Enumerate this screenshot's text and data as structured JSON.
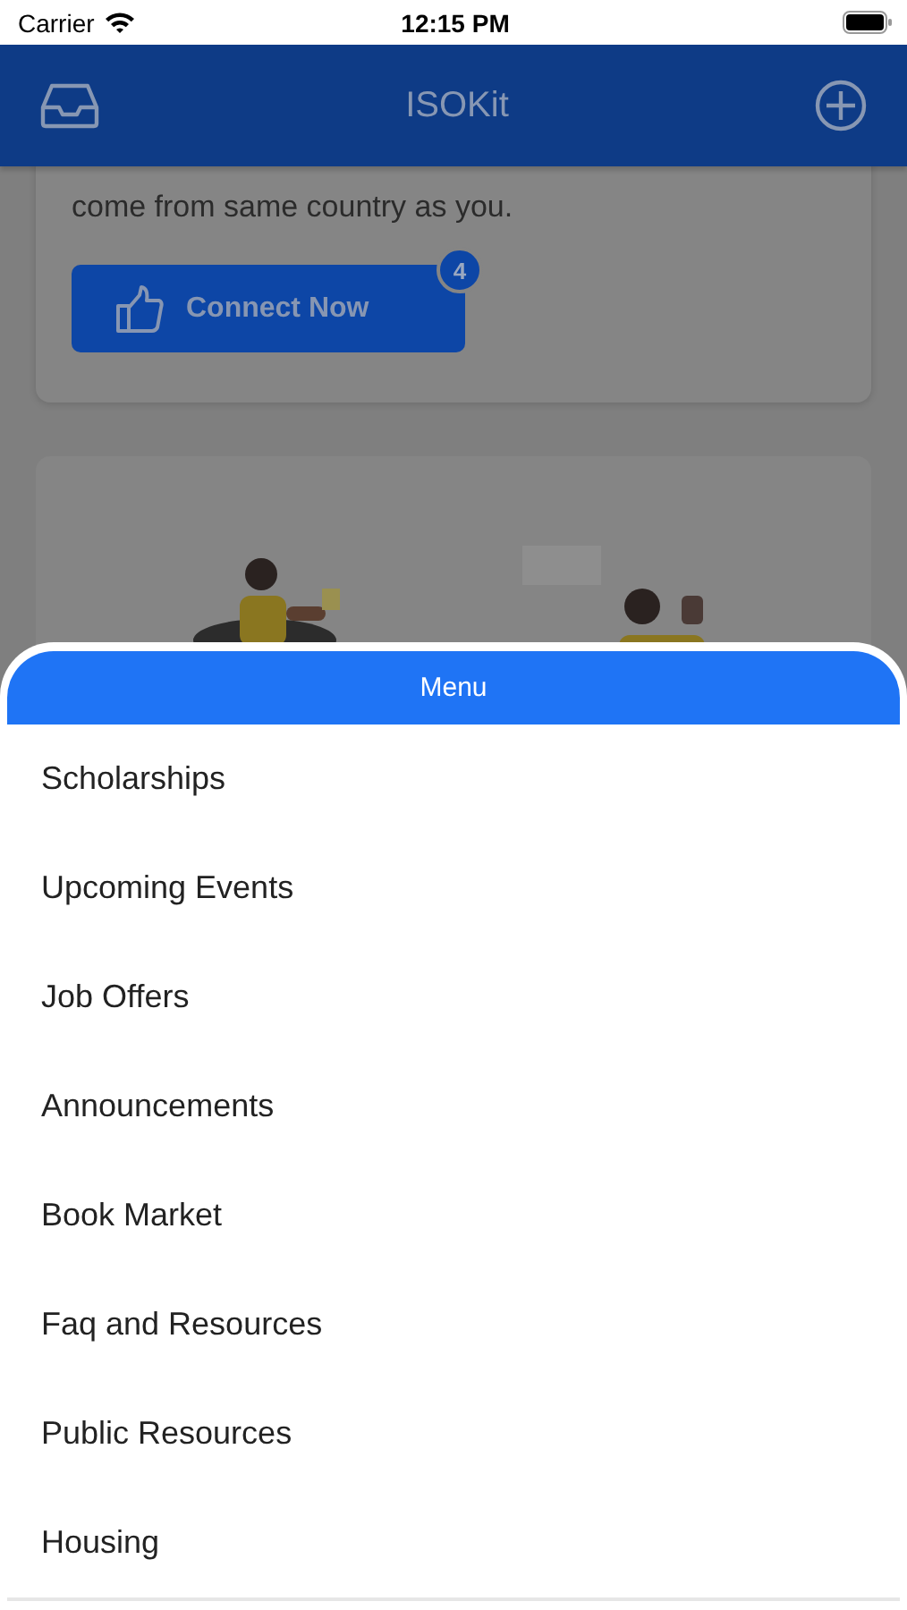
{
  "status_bar": {
    "carrier": "Carrier",
    "time": "12:15 PM"
  },
  "header": {
    "title": "ISOKit"
  },
  "connect_card": {
    "text_lines": [
      "come from same country as you."
    ],
    "button": "Connect Now",
    "badge": "4"
  },
  "menu": {
    "title": "Menu",
    "items": [
      {
        "label": "Scholarships"
      },
      {
        "label": "Upcoming Events"
      },
      {
        "label": "Job Offers"
      },
      {
        "label": "Announcements"
      },
      {
        "label": "Book Market"
      },
      {
        "label": "Faq and Resources"
      },
      {
        "label": "Public Resources"
      },
      {
        "label": "Housing"
      }
    ]
  }
}
